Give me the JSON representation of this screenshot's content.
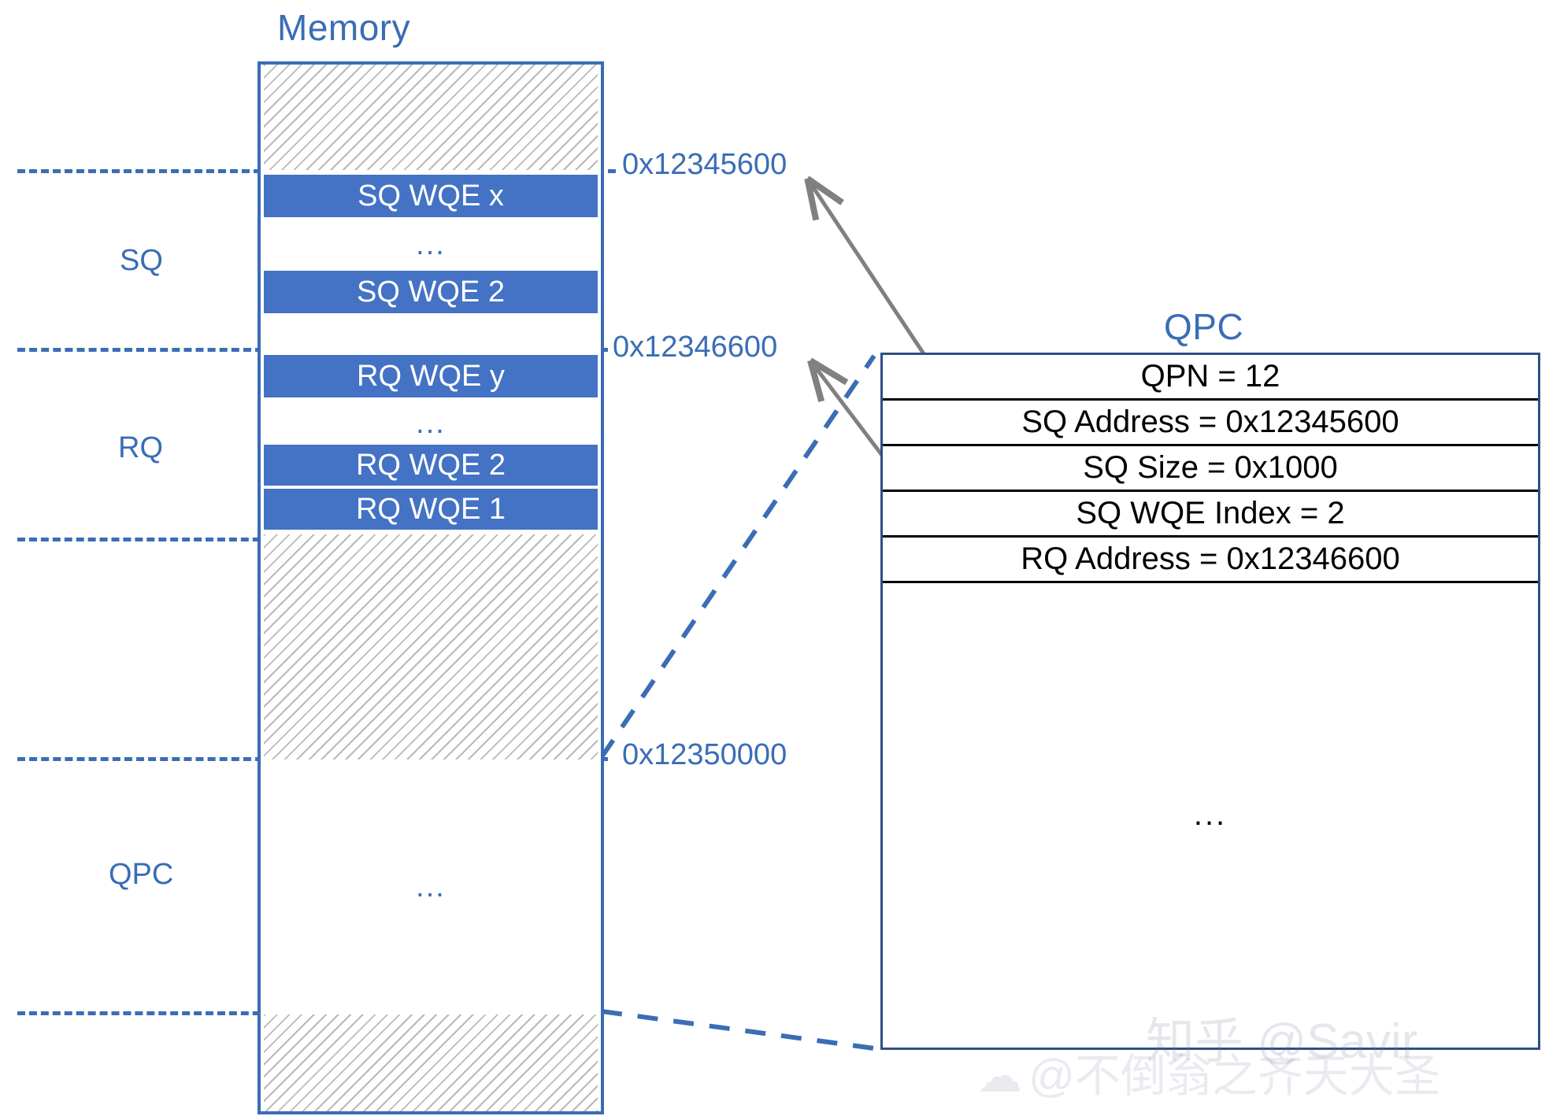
{
  "memory": {
    "title": "Memory",
    "blocks": [
      {
        "name": "top-unused",
        "kind": "hatched",
        "label": ""
      },
      {
        "name": "sq-wqe-x",
        "kind": "wqe",
        "label": "SQ WQE x"
      },
      {
        "name": "sq-gap-1",
        "kind": "blank",
        "label": ""
      },
      {
        "name": "sq-ellipsis",
        "kind": "dots",
        "label": "..."
      },
      {
        "name": "sq-wqe-2",
        "kind": "wqe",
        "label": "SQ WQE 2"
      },
      {
        "name": "sq-gap-2",
        "kind": "blank",
        "label": ""
      },
      {
        "name": "rq-wqe-y",
        "kind": "wqe",
        "label": "RQ WQE y"
      },
      {
        "name": "rq-ellipsis",
        "kind": "dots",
        "label": "..."
      },
      {
        "name": "rq-wqe-2",
        "kind": "wqe",
        "label": "RQ WQE 2"
      },
      {
        "name": "rq-wqe-1",
        "kind": "wqe",
        "label": "RQ WQE 1"
      },
      {
        "name": "mid-unused",
        "kind": "hatched",
        "label": ""
      },
      {
        "name": "qpc-region",
        "kind": "dots",
        "label": "..."
      },
      {
        "name": "bottom-unused",
        "kind": "hatched",
        "label": ""
      }
    ]
  },
  "region_labels": {
    "sq": "SQ",
    "rq": "RQ",
    "qpc": "QPC"
  },
  "addresses": {
    "sq_start": "0x12345600",
    "rq_start": "0x12346600",
    "qpc_start": "0x12350000"
  },
  "qpc": {
    "title": "QPC",
    "rows": [
      "QPN = 12",
      "SQ Address = 0x12345600",
      "SQ Size = 0x1000",
      "SQ WQE Index = 2",
      "RQ Address = 0x12346600"
    ],
    "body_ellipsis": "..."
  },
  "watermarks": {
    "zhihu": "知乎 @Savir",
    "weibo": "@不倒翁之齐天大圣"
  },
  "colors": {
    "accent_blue": "#3a6db5",
    "wqe_blue": "#4472c4",
    "table_border": "#2f4f84",
    "arrow_gray": "#808080",
    "hatch_gray": "#b9b9b9"
  }
}
